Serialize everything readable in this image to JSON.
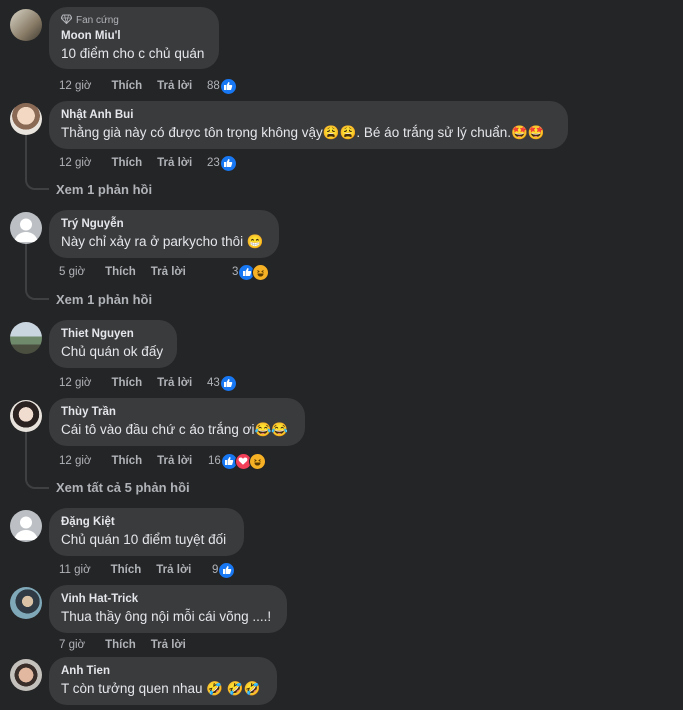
{
  "reaction_colors": {
    "like": "#1877f2",
    "love": "#f33e58",
    "haha": "#f7b125"
  },
  "comments": [
    {
      "badge": "Fan cứng",
      "name": "Moon Miu'l",
      "text": "10 điểm cho c chủ quán",
      "time": "12 giờ",
      "like": "Thích",
      "reply": "Trả lời",
      "count": "88",
      "reactions": [
        "like"
      ]
    },
    {
      "name": "Nhật Anh Bui",
      "text": "Thằng già này có được tôn trọng không vậy😩😩. Bé áo trắng sử lý chuẩn.🤩🤩",
      "time": "12 giờ",
      "like": "Thích",
      "reply": "Trả lời",
      "count": "23",
      "reactions": [
        "like"
      ],
      "view_replies": "Xem 1 phản hồi"
    },
    {
      "name": "Trý Nguyễn",
      "text": "Này chỉ xảy ra ở parkycho thôi 😁",
      "time": "5 giờ",
      "like": "Thích",
      "reply": "Trả lời",
      "count": "3",
      "reactions": [
        "like",
        "haha"
      ],
      "view_replies": "Xem 1 phản hồi"
    },
    {
      "name": "Thiet Nguyen",
      "text": "Chủ quán ok đấy",
      "time": "12 giờ",
      "like": "Thích",
      "reply": "Trả lời",
      "count": "43",
      "reactions": [
        "like"
      ]
    },
    {
      "name": "Thùy Trần",
      "text": "Cái tô vào đầu chứ c áo trắng ơi😂😂",
      "time": "12 giờ",
      "like": "Thích",
      "reply": "Trả lời",
      "count": "16",
      "reactions": [
        "like",
        "love",
        "haha"
      ],
      "view_replies": "Xem tất cả 5 phản hồi"
    },
    {
      "name": "Đặng Kiệt",
      "text": "Chủ quán 10 điểm tuyệt đối",
      "time": "11 giờ",
      "like": "Thích",
      "reply": "Trả lời",
      "count": "9",
      "reactions": [
        "like"
      ]
    },
    {
      "name": "Vinh Hat-Trick",
      "text": "Thua thầy ông nội mỗi cái võng ....!",
      "time": "7 giờ",
      "like": "Thích",
      "reply": "Trả lời"
    },
    {
      "name": "Anh Tien",
      "text": "T còn tưởng quen nhau 🤣 🤣🤣"
    }
  ]
}
